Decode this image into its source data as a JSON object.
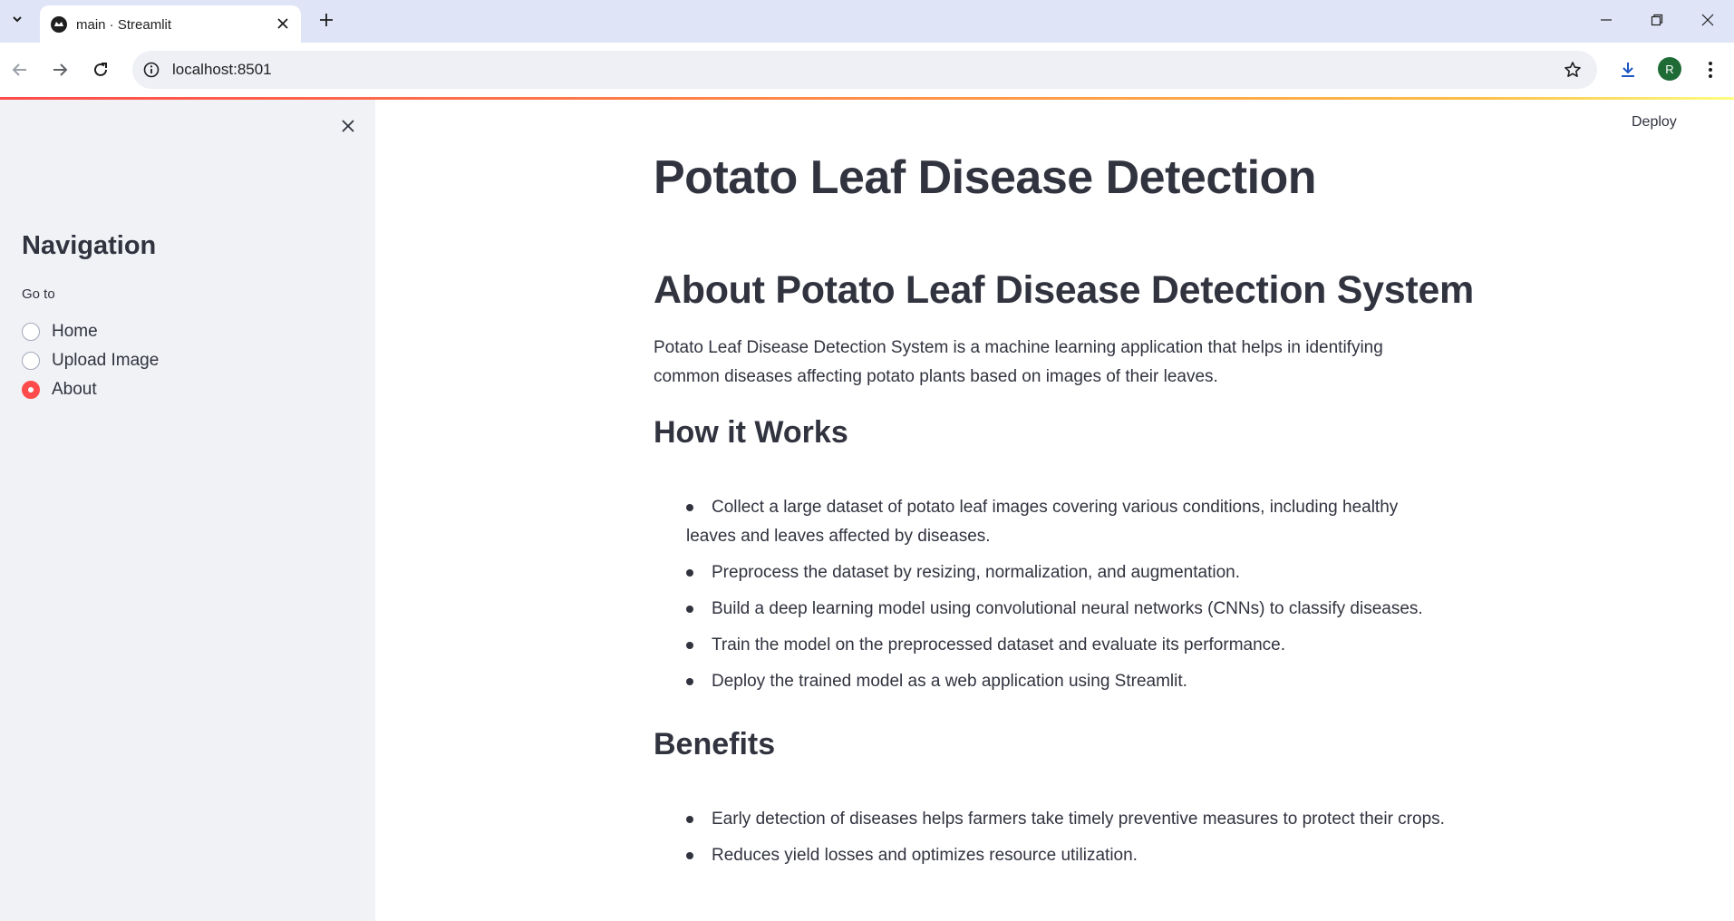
{
  "browser": {
    "tab_title": "main · Streamlit",
    "url": "localhost:8501",
    "avatar_letter": "R"
  },
  "app": {
    "deploy_label": "Deploy",
    "sidebar": {
      "title": "Navigation",
      "radio_label": "Go to",
      "options": [
        {
          "label": "Home",
          "selected": false
        },
        {
          "label": "Upload Image",
          "selected": false
        },
        {
          "label": "About",
          "selected": true
        }
      ]
    },
    "main": {
      "title": "Potato Leaf Disease Detection",
      "about_heading": "About Potato Leaf Disease Detection System",
      "intro": "Potato Leaf Disease Detection System is a machine learning application that helps in identifying common diseases affecting potato plants based on images of their leaves.",
      "how_heading": "How it Works",
      "how_items": [
        "Collect a large dataset of potato leaf images covering various conditions, including healthy leaves and leaves affected by diseases.",
        "Preprocess the dataset by resizing, normalization, and augmentation.",
        "Build a deep learning model using convolutional neural networks (CNNs) to classify diseases.",
        "Train the model on the preprocessed dataset and evaluate its performance.",
        "Deploy the trained model as a web application using Streamlit."
      ],
      "benefits_heading": "Benefits",
      "benefits_items": [
        "Early detection of diseases helps farmers take timely preventive measures to protect their crops.",
        "Reduces yield losses and optimizes resource utilization."
      ]
    }
  },
  "colors": {
    "accent": "#ff4b4b",
    "sidebar_bg": "#f0f2f6",
    "text": "#31333f"
  }
}
